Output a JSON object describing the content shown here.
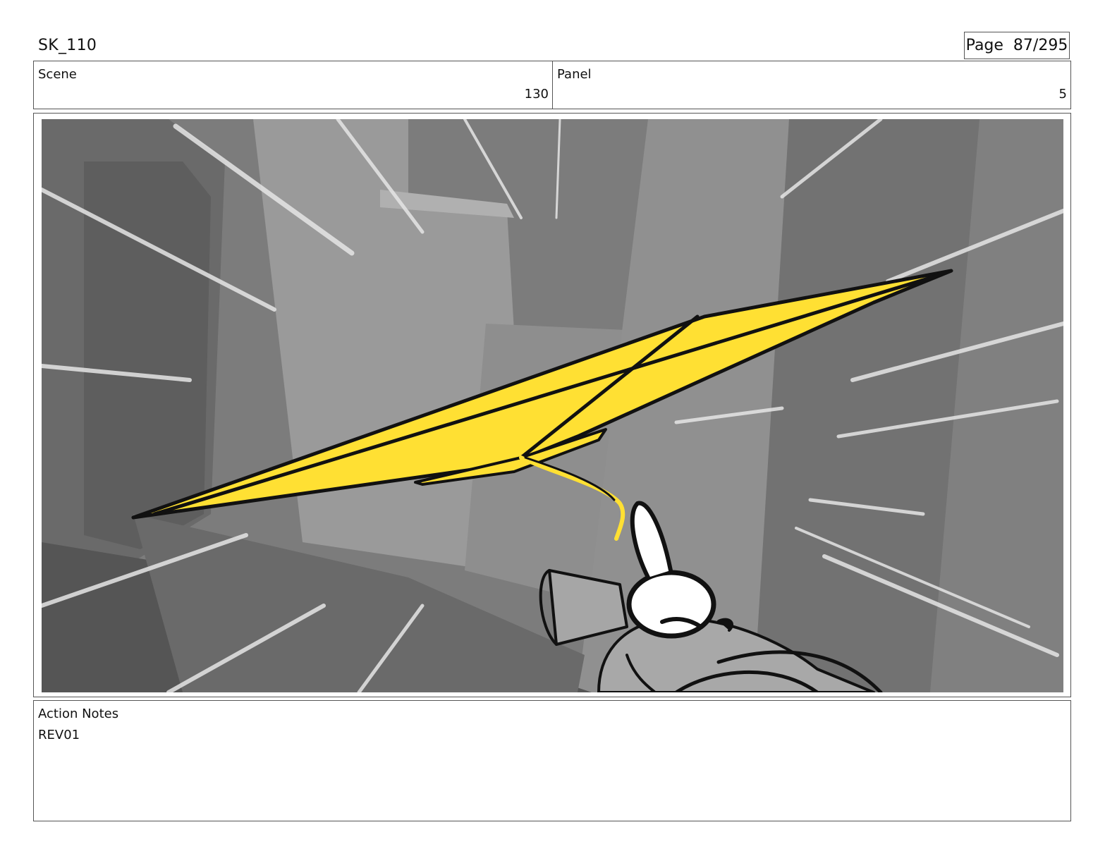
{
  "header": {
    "sheet_title": "SK_110",
    "page_label": "Page  87/295"
  },
  "info": {
    "scene_label": "Scene",
    "scene_value": "130",
    "panel_label": "Panel",
    "panel_value": "5"
  },
  "panel_image": {
    "description_icon": "storyboard-drawing",
    "accent_color": "#ffe033"
  },
  "notes": {
    "label": "Action Notes",
    "text": "REV01"
  }
}
